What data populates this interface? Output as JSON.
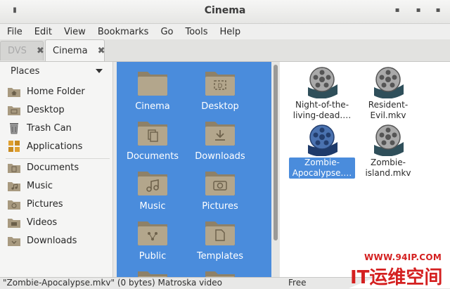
{
  "window": {
    "title": "Cinema"
  },
  "menu": [
    "File",
    "Edit",
    "View",
    "Bookmarks",
    "Go",
    "Tools",
    "Help"
  ],
  "tabs": [
    {
      "label": "DVS",
      "active": false
    },
    {
      "label": "Cinema",
      "active": true
    }
  ],
  "sidebar": {
    "header": "Places",
    "items": [
      {
        "label": "Home Folder",
        "icon": "home-folder-icon"
      },
      {
        "label": "Desktop",
        "icon": "desktop-folder-icon"
      },
      {
        "label": "Trash Can",
        "icon": "trash-icon"
      },
      {
        "label": "Applications",
        "icon": "applications-icon"
      },
      {
        "label": "Documents",
        "icon": "documents-folder-icon"
      },
      {
        "label": "Music",
        "icon": "music-folder-icon"
      },
      {
        "label": "Pictures",
        "icon": "pictures-folder-icon"
      },
      {
        "label": "Videos",
        "icon": "videos-folder-icon"
      },
      {
        "label": "Downloads",
        "icon": "downloads-folder-icon"
      }
    ]
  },
  "left_pane": {
    "folders": [
      {
        "label": "Cinema",
        "icon": "folder-icon"
      },
      {
        "label": "Desktop",
        "icon": "desktop-folder-icon"
      },
      {
        "label": "Documents",
        "icon": "documents-folder-icon"
      },
      {
        "label": "Downloads",
        "icon": "downloads-folder-icon"
      },
      {
        "label": "Music",
        "icon": "music-folder-icon"
      },
      {
        "label": "Pictures",
        "icon": "pictures-folder-icon"
      },
      {
        "label": "Public",
        "icon": "public-folder-icon"
      },
      {
        "label": "Templates",
        "icon": "templates-folder-icon"
      }
    ]
  },
  "right_pane": {
    "files": [
      {
        "line1": "Night-of-the-",
        "line2": "living-dead.…",
        "icon": "video-reel-icon",
        "selected": false
      },
      {
        "line1": "Resident-",
        "line2": "Evil.mkv",
        "icon": "video-reel-icon",
        "selected": false
      },
      {
        "line1": "Zombie-",
        "line2": "Apocalypse.…",
        "icon": "video-reel-icon",
        "selected": true
      },
      {
        "line1": "Zombie-",
        "line2": "island.mkv",
        "icon": "video-reel-icon",
        "selected": false
      }
    ]
  },
  "status": {
    "text": "\"Zombie-Apocalypse.mkv\" (0 bytes) Matroska video",
    "free": "Free"
  },
  "watermark": {
    "url": "WWW.94IP.COM",
    "main": "IT运维空间"
  },
  "colors": {
    "selection": "#4a8cdc",
    "folder": "#a89a80",
    "watermark": "#d42020"
  }
}
